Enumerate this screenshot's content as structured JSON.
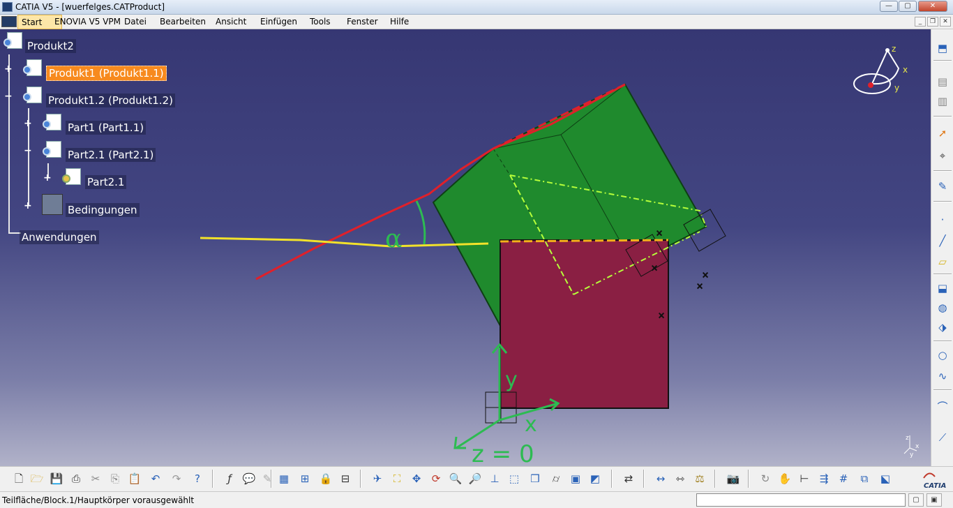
{
  "window": {
    "title": "CATIA V5 - [wuerfelges.CATProduct]",
    "controls": {
      "minimize": "—",
      "maximize": "▢",
      "close": "✕"
    }
  },
  "menubar": {
    "items": [
      "Start",
      "ENOVIA V5 VPM",
      "Datei",
      "Bearbeiten",
      "Ansicht",
      "Einfügen",
      "Tools",
      "Fenster",
      "Hilfe"
    ],
    "mdi_controls": {
      "minimize": "_",
      "restore": "❐",
      "close": "✕"
    }
  },
  "tree": {
    "nodes": [
      {
        "label": "Produkt2",
        "icon": "product-icon",
        "selected": false
      },
      {
        "label": "Produkt1 (Produkt1.1)",
        "icon": "product-icon",
        "selected": true,
        "toggle": "+"
      },
      {
        "label": "Produkt1.2 (Produkt1.2)",
        "icon": "product-icon",
        "selected": false,
        "toggle": "−"
      },
      {
        "label": "Part1 (Part1.1)",
        "icon": "part-icon",
        "selected": false,
        "toggle": "+"
      },
      {
        "label": "Part2.1 (Part2.1)",
        "icon": "part-icon",
        "selected": false,
        "toggle": "−"
      },
      {
        "label": "Part2.1",
        "icon": "part-body-icon",
        "selected": false,
        "toggle": "+"
      },
      {
        "label": "Bedingungen",
        "icon": "constraints-icon",
        "selected": false,
        "toggle": "+"
      },
      {
        "label": "Anwendungen",
        "icon": "",
        "selected": false
      }
    ]
  },
  "sketch": {
    "angle_symbol": "α",
    "axis_labels": {
      "x": "x",
      "y": "y",
      "z": "z"
    },
    "equation": "z = 0"
  },
  "compass": {
    "x": "x",
    "y": "y",
    "z": "z"
  },
  "right_toolbar": {
    "icons": [
      "assembly-workbench-icon",
      "catalog-icon",
      "catalog-2-icon",
      "select-arrow-icon",
      "select-trap-icon",
      "sketch-icon",
      "point-icon",
      "line-icon",
      "plane-icon",
      "extrude-icon",
      "revolve-icon",
      "sweep-icon",
      "circle-icon",
      "spline-icon",
      "law-icon",
      "analysis-icon"
    ]
  },
  "bottom_toolbar": {
    "icons": [
      "new-icon",
      "open-icon",
      "save-icon",
      "print-icon",
      "cut-icon",
      "copy-icon",
      "paste-icon",
      "undo-icon",
      "redo-icon",
      "whats-this-icon",
      "formula-icon",
      "comment-icon",
      "knowledge-icon",
      "table-icon",
      "product-structure-icon",
      "lock-icon",
      "parameters-icon",
      "fly-mode-icon",
      "fit-all-icon",
      "pan-icon",
      "rotate-icon",
      "zoom-in-icon",
      "zoom-out-icon",
      "normal-view-icon",
      "iso-view-icon",
      "box-view-icon",
      "cylinder-view-icon",
      "shading-icon",
      "hide-show-icon",
      "swap-visible-icon",
      "measure-icon",
      "measure-2-icon",
      "mass-icon",
      "capture-icon",
      "update-icon",
      "manipulate-icon",
      "snap-icon",
      "compass-icon",
      "grid-icon",
      "explode-icon",
      "constraints-icon"
    ]
  },
  "catia_logo": "CATIA",
  "statusbar": {
    "text": "Teilfläche/Block.1/Hauptkörper vorausgewählt",
    "command_placeholder": ""
  },
  "colors": {
    "viewport_top": "#363773",
    "viewport_bottom": "#b1b2c9",
    "green_cube": "#1f8a2d",
    "red_face": "#8a1f43",
    "selection": "#f78a1e",
    "annotation_red": "#e0202a",
    "annotation_yellow": "#f2e22a",
    "annotation_green": "#2dbb52"
  }
}
